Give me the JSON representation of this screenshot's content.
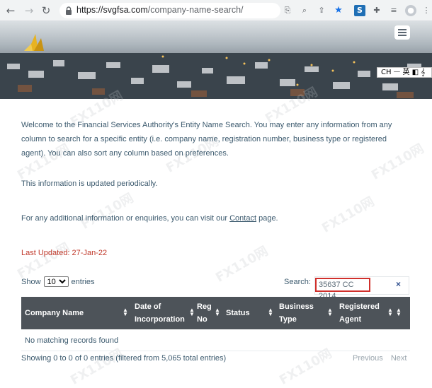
{
  "browser": {
    "url_host": "https://svgfsa.com",
    "url_path": "/company-name-search/",
    "ime_text": "CH 𑁋 英 ◧ 𝄞"
  },
  "hero": {
    "logo_icon": "fsa-logo-icon",
    "menu_icon": "hamburger-menu-icon"
  },
  "intro": {
    "paragraph": "Welcome to the Financial Services Authority's Entity Name Search. You may enter any information from any column to search for a specific entity (i.e. company name, registration number, business type or registered agent). You can also sort any column based on preferences.",
    "updated_note": "This information is updated periodically.",
    "contact_prefix": "For any additional information or enquiries, you can visit our ",
    "contact_link": "Contact",
    "contact_suffix": " page."
  },
  "last_updated": {
    "label": "Last Updated:  27-Jan-22"
  },
  "table_controls": {
    "show_label": "Show",
    "entries_value": "10",
    "entries_label": "entries",
    "search_label": "Search:",
    "search_value": "35637 CC 2014",
    "clear_glyph": "×"
  },
  "table": {
    "columns": [
      {
        "label": "Company Name"
      },
      {
        "label": "Date of Incorporation"
      },
      {
        "label": "Reg No"
      },
      {
        "label": "Status"
      },
      {
        "label": "Business Type"
      },
      {
        "label": "Registered Agent"
      }
    ],
    "empty_message": "No matching records found",
    "info": "Showing 0 to 0 of 0 entries (filtered from 5,065 total entries)",
    "previous_label": "Previous",
    "next_label": "Next"
  },
  "watermark": "FX110网"
}
